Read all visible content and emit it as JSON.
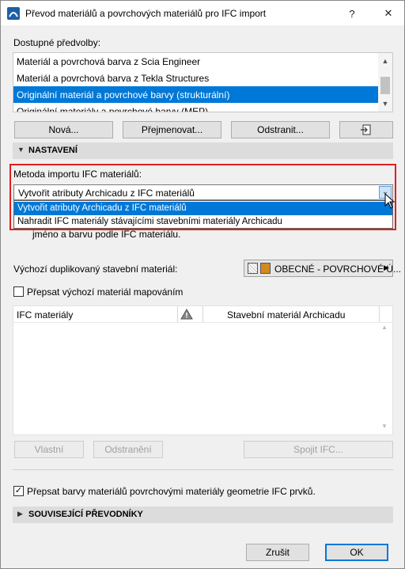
{
  "window": {
    "title": "Převod materiálů a povrchových materiálů pro IFC import"
  },
  "presets": {
    "label": "Dostupné předvolby:",
    "items": [
      "Materiál a povrchová barva z Scia Engineer",
      "Materiál a povrchová barva z Tekla Structures",
      "Originální materiál a povrchové barvy (strukturální)",
      "Originální materiály a povrchové barvy (MEP)"
    ],
    "selected_index": 2
  },
  "preset_buttons": {
    "new": "Nová...",
    "rename": "Přejmenovat...",
    "remove": "Odstranit..."
  },
  "settings": {
    "header": "NASTAVENÍ",
    "method_label": "Metoda importu IFC materiálů:",
    "method_value": "Vytvořit atributy Archicadu z IFC materiálů",
    "method_options": [
      "Vytvořit atributy Archicadu z IFC materiálů",
      "Nahradit IFC materiály stávajícími stavebními materiály Archicadu"
    ],
    "hidden_note": "jméno a barvu podle IFC materiálu.",
    "default_label": "Výchozí duplikovaný stavební materiál:",
    "default_value": "OBECNÉ - POVRCHOVÉ Ú...",
    "override_mapping_label": "Přepsat výchozí materiál mapováním",
    "override_mapping_checked": false
  },
  "table": {
    "col_ifc": "IFC materiály",
    "col_archicad": "Stavební materiál Archicadu"
  },
  "table_buttons": {
    "custom": "Vlastní",
    "remove": "Odstranění",
    "merge": "Spojit IFC..."
  },
  "override_colors": {
    "label": "Přepsat barvy materiálů povrchovými materiály geometrie IFC prvků.",
    "checked": true
  },
  "related": {
    "header": "SOUVISEJÍCÍ PŘEVODNÍKY"
  },
  "footer": {
    "cancel": "Zrušit",
    "ok": "OK"
  },
  "colors": {
    "accent": "#0078d7",
    "highlight_frame": "#e02020",
    "material_swatch": "#d48a1c"
  }
}
